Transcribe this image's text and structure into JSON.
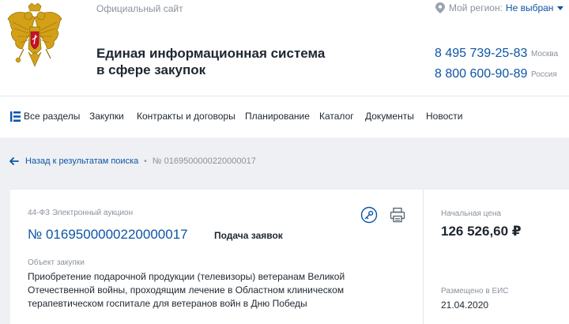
{
  "header": {
    "official_site": "Официальный сайт",
    "region_label": "Мой регион:",
    "region_value": "Не выбран",
    "title_line1": "Единая информационная система",
    "title_line2": "в сфере закупок",
    "phones": [
      {
        "number": "8 495 739-25-83",
        "note": "Москва"
      },
      {
        "number": "8 800 600-90-89",
        "note": "Россия"
      }
    ]
  },
  "nav": {
    "items": [
      "Все разделы",
      "Закупки",
      "Контракты и договоры",
      "Планирование",
      "Каталог",
      "Документы",
      "Новости"
    ]
  },
  "breadcrumb": {
    "back": "Назад к результатам поиска",
    "separator": "•",
    "current": "№ 0169500000220000017"
  },
  "purchase": {
    "law_type": "44-ФЗ  Электронный аукцион",
    "number": "№ 0169500000220000017",
    "status": "Подача заявок",
    "object_label": "Объект закупки",
    "object_text": "Приобретение подарочной продукции (телевизоры) ветеранам Великой Отечественной войны, проходящим лечение в Областном клиническом терапевтическом госпитале для ветеранов войн в Дню Победы",
    "price_label": "Начальная цена",
    "price": "126 526,60 ₽",
    "placed_label": "Размещено в ЕИС",
    "placed_date": "21.04.2020"
  },
  "colors": {
    "accent": "#0d55a6",
    "muted": "#8a929c",
    "page_bg": "#eef0f3"
  }
}
